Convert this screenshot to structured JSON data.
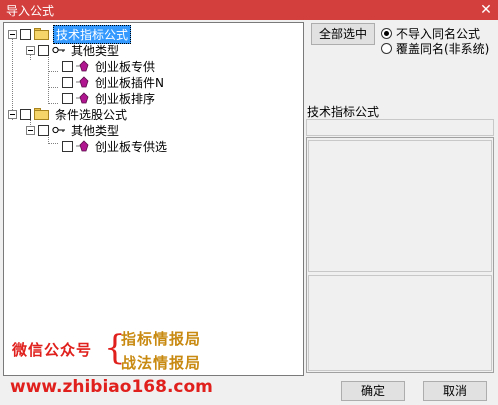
{
  "window": {
    "title": "导入公式",
    "close_glyph": "✕"
  },
  "tree": {
    "nodes": [
      {
        "label": "技术指标公式",
        "type": "folder",
        "selected": true
      },
      {
        "label": "其他类型",
        "type": "category"
      },
      {
        "label": "创业板专供",
        "type": "formula"
      },
      {
        "label": "创业板插件N",
        "type": "formula"
      },
      {
        "label": "创业板排序",
        "type": "formula"
      },
      {
        "label": "条件选股公式",
        "type": "folder",
        "selected": false
      },
      {
        "label": "其他类型",
        "type": "category"
      },
      {
        "label": "创业板专供选",
        "type": "formula"
      }
    ]
  },
  "options": {
    "select_all_label": "全部选中",
    "radio_skip_label": "不导入同名公式",
    "radio_overwrite_label": "覆盖同名(非系统)",
    "selected_radio": "skip"
  },
  "detail": {
    "label": "技术指标公式"
  },
  "buttons": {
    "ok": "确定",
    "cancel": "取消"
  },
  "watermark": {
    "wechat": "微信公众号",
    "brand1": "指标情报局",
    "brand2": "战法情报局",
    "url": "www.zhibiao168.com"
  },
  "colors": {
    "title_bar": "#d33f3d",
    "selection": "#3399ff",
    "watermark_red": "#e0201c",
    "watermark_gold": "#c98a12"
  }
}
